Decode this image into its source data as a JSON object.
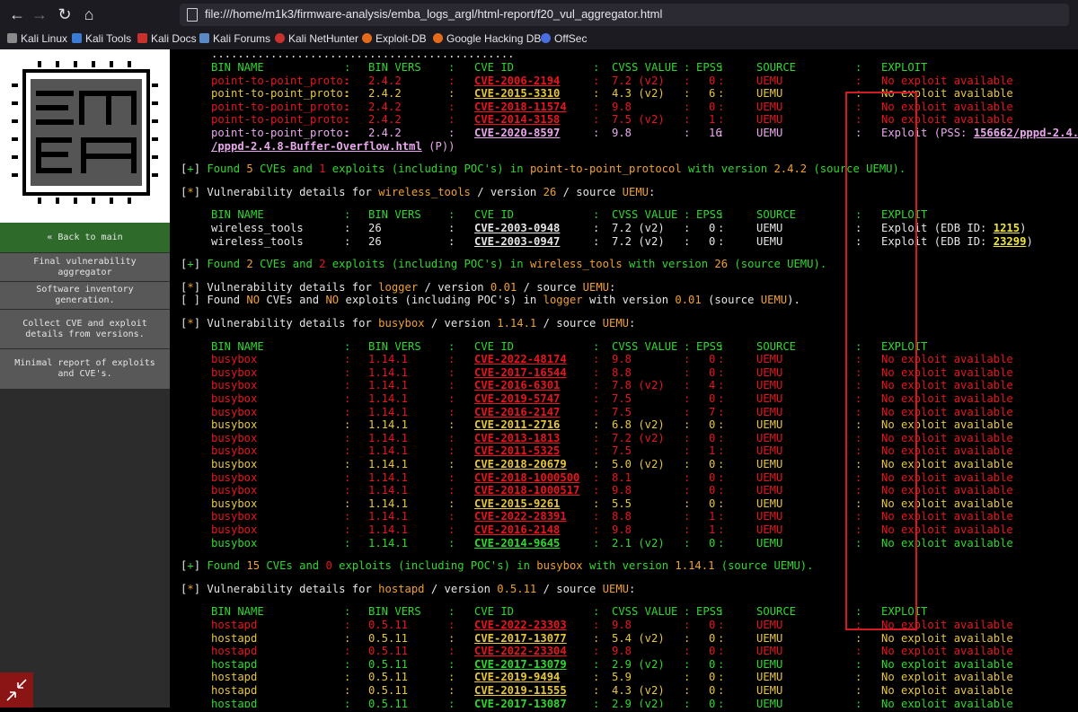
{
  "browser": {
    "url": "file:///home/m1k3/firmware-analysis/emba_logs_argl/html-report/f20_vul_aggregator.html",
    "bookmarks": [
      "Kali Linux",
      "Kali Tools",
      "Kali Docs",
      "Kali Forums",
      "Kali NetHunter",
      "Exploit-DB",
      "Google Hacking DB",
      "OffSec"
    ]
  },
  "sidebar": {
    "back_label": "« Back to main",
    "items": [
      "Final vulnerability aggregator",
      "Software inventory generation.",
      "Collect CVE and exploit details from versions.",
      "Minimal report of exploits and CVE's."
    ]
  },
  "headers": {
    "bin_name": "BIN NAME",
    "bin_vers": "BIN VERS",
    "cve_id": "CVE ID",
    "cvss_value": "CVSS VALUE",
    "epss": "EPSS",
    "source": "SOURCE",
    "exploit": "EXPLOIT"
  },
  "sections": [
    {
      "rows": [
        {
          "bin": "point-to-point_proto:",
          "vers": "2.4.2",
          "cve": "CVE-2006-2194",
          "cvss": "7.2 (v2)",
          "epss": "0",
          "src": "UEMU",
          "exploit": "No exploit available",
          "color": "r"
        },
        {
          "bin": "point-to-point_proto:",
          "vers": "2.4.2",
          "cve": "CVE-2015-3310",
          "cvss": "4.3 (v2)",
          "epss": "6",
          "src": "UEMU",
          "exploit": "No exploit available",
          "color": "y"
        },
        {
          "bin": "point-to-point_proto:",
          "vers": "2.4.2",
          "cve": "CVE-2018-11574",
          "cvss": "9.8",
          "epss": "0",
          "src": "UEMU",
          "exploit": "No exploit available",
          "color": "r"
        },
        {
          "bin": "point-to-point_proto:",
          "vers": "2.4.2",
          "cve": "CVE-2014-3158",
          "cvss": "7.5 (v2)",
          "epss": "1",
          "src": "UEMU",
          "exploit": "No exploit available",
          "color": "r"
        },
        {
          "bin": "point-to-point_proto:",
          "vers": "2.4.2",
          "cve": "CVE-2020-8597",
          "cvss": "9.8",
          "epss": "16",
          "src": "UEMU",
          "exploit": "Exploit (PSS: ",
          "exploit_link": "156662/pppd-2.4.",
          "color": "m"
        }
      ],
      "wrap": "/pppd-2.4.8-Buffer-Overflow.html",
      "wrap_suffix": " (P))",
      "summary": {
        "pre": "Found ",
        "cves": "5",
        "mid1": " CVEs and ",
        "exploits": "1",
        "mid2": " exploits (including POC's) in ",
        "name": "point-to-point_protocol",
        "mid3": " with version ",
        "version": "2.4.2",
        "post": " (source UEMU)."
      }
    },
    {
      "header": {
        "pre": "Vulnerability details for ",
        "name": "wireless_tools",
        "mid": " / version ",
        "version": "26",
        "post": " / source ",
        "src": "UEMU",
        ":": ":"
      },
      "rows": [
        {
          "bin": "wireless_tools",
          "vers": "26",
          "cve": "CVE-2003-0948",
          "cvss": "7.2 (v2)",
          "epss": "0",
          "src": "UEMU",
          "exploit": "Exploit (EDB ID: ",
          "exploit_link": "1215",
          "exploit_post": ")",
          "color": "w"
        },
        {
          "bin": "wireless_tools",
          "vers": "26",
          "cve": "CVE-2003-0947",
          "cvss": "7.2 (v2)",
          "epss": "0",
          "src": "UEMU",
          "exploit": "Exploit (EDB ID: ",
          "exploit_link": "23299",
          "exploit_post": ")",
          "color": "w"
        }
      ],
      "summary": {
        "pre": "Found ",
        "cves": "2",
        "mid1": " CVEs and ",
        "exploits": "2",
        "mid2": " exploits (including POC's) in ",
        "name": "wireless_tools",
        "mid3": " with version ",
        "version": "26",
        "post": " (source UEMU)."
      }
    },
    {
      "header": {
        "pre": "Vulnerability details for ",
        "name": "logger",
        "mid": " / version ",
        "version": "0.01",
        "post": " / source ",
        "src": "UEMU"
      },
      "none": {
        "pre": "Found ",
        "no1": "NO",
        "mid1": " CVEs and ",
        "no2": "NO",
        "mid2": " exploits (including POC's) in ",
        "name": "logger",
        "mid3": " with version ",
        "version": "0.01",
        "post": " (source ",
        "src": "UEMU",
        "end": ")."
      }
    },
    {
      "header": {
        "pre": "Vulnerability details for ",
        "name": "busybox",
        "mid": " / version ",
        "version": "1.14.1",
        "post": " / source ",
        "src": "UEMU"
      },
      "rows": [
        {
          "bin": "busybox",
          "vers": "1.14.1",
          "cve": "CVE-2022-48174",
          "cvss": "9.8",
          "epss": "0",
          "src": "UEMU",
          "exploit": "No exploit available",
          "color": "r"
        },
        {
          "bin": "busybox",
          "vers": "1.14.1",
          "cve": "CVE-2017-16544",
          "cvss": "8.8",
          "epss": "0",
          "src": "UEMU",
          "exploit": "No exploit available",
          "color": "r"
        },
        {
          "bin": "busybox",
          "vers": "1.14.1",
          "cve": "CVE-2016-6301",
          "cvss": "7.8 (v2)",
          "epss": "4",
          "src": "UEMU",
          "exploit": "No exploit available",
          "color": "r"
        },
        {
          "bin": "busybox",
          "vers": "1.14.1",
          "cve": "CVE-2019-5747",
          "cvss": "7.5",
          "epss": "0",
          "src": "UEMU",
          "exploit": "No exploit available",
          "color": "r"
        },
        {
          "bin": "busybox",
          "vers": "1.14.1",
          "cve": "CVE-2016-2147",
          "cvss": "7.5",
          "epss": "7",
          "src": "UEMU",
          "exploit": "No exploit available",
          "color": "r"
        },
        {
          "bin": "busybox",
          "vers": "1.14.1",
          "cve": "CVE-2011-2716",
          "cvss": "6.8 (v2)",
          "epss": "0",
          "src": "UEMU",
          "exploit": "No exploit available",
          "color": "y"
        },
        {
          "bin": "busybox",
          "vers": "1.14.1",
          "cve": "CVE-2013-1813",
          "cvss": "7.2 (v2)",
          "epss": "0",
          "src": "UEMU",
          "exploit": "No exploit available",
          "color": "r"
        },
        {
          "bin": "busybox",
          "vers": "1.14.1",
          "cve": "CVE-2011-5325",
          "cvss": "7.5",
          "epss": "1",
          "src": "UEMU",
          "exploit": "No exploit available",
          "color": "r"
        },
        {
          "bin": "busybox",
          "vers": "1.14.1",
          "cve": "CVE-2018-20679",
          "cvss": "5.0 (v2)",
          "epss": "0",
          "src": "UEMU",
          "exploit": "No exploit available",
          "color": "y"
        },
        {
          "bin": "busybox",
          "vers": "1.14.1",
          "cve": "CVE-2018-1000500",
          "cvss": "8.1",
          "epss": "0",
          "src": "UEMU",
          "exploit": "No exploit available",
          "color": "r"
        },
        {
          "bin": "busybox",
          "vers": "1.14.1",
          "cve": "CVE-2018-1000517",
          "cvss": "9.8",
          "epss": "0",
          "src": "UEMU",
          "exploit": "No exploit available",
          "color": "r"
        },
        {
          "bin": "busybox",
          "vers": "1.14.1",
          "cve": "CVE-2015-9261",
          "cvss": "5.5",
          "epss": "0",
          "src": "UEMU",
          "exploit": "No exploit available",
          "color": "y"
        },
        {
          "bin": "busybox",
          "vers": "1.14.1",
          "cve": "CVE-2022-28391",
          "cvss": "8.8",
          "epss": "1",
          "src": "UEMU",
          "exploit": "No exploit available",
          "color": "r"
        },
        {
          "bin": "busybox",
          "vers": "1.14.1",
          "cve": "CVE-2016-2148",
          "cvss": "9.8",
          "epss": "1",
          "src": "UEMU",
          "exploit": "No exploit available",
          "color": "r"
        },
        {
          "bin": "busybox",
          "vers": "1.14.1",
          "cve": "CVE-2014-9645",
          "cvss": "2.1 (v2)",
          "epss": "0",
          "src": "UEMU",
          "exploit": "No exploit available",
          "color": "g"
        }
      ],
      "summary": {
        "pre": "Found ",
        "cves": "15",
        "mid1": " CVEs and ",
        "exploits": "0",
        "mid2": " exploits (including POC's) in ",
        "name": "busybox",
        "mid3": " with version ",
        "version": "1.14.1",
        "post": " (source UEMU)."
      }
    },
    {
      "header": {
        "pre": "Vulnerability details for ",
        "name": "hostapd",
        "mid": " / version ",
        "version": "0.5.11",
        "post": " / source ",
        "src": "UEMU"
      },
      "rows": [
        {
          "bin": "hostapd",
          "vers": "0.5.11",
          "cve": "CVE-2022-23303",
          "cvss": "9.8",
          "epss": "0",
          "src": "UEMU",
          "exploit": "No exploit available",
          "color": "r"
        },
        {
          "bin": "hostapd",
          "vers": "0.5.11",
          "cve": "CVE-2017-13077",
          "cvss": "5.4 (v2)",
          "epss": "0",
          "src": "UEMU",
          "exploit": "No exploit available",
          "color": "y"
        },
        {
          "bin": "hostapd",
          "vers": "0.5.11",
          "cve": "CVE-2022-23304",
          "cvss": "9.8",
          "epss": "0",
          "src": "UEMU",
          "exploit": "No exploit available",
          "color": "r"
        },
        {
          "bin": "hostapd",
          "vers": "0.5.11",
          "cve": "CVE-2017-13079",
          "cvss": "2.9 (v2)",
          "epss": "0",
          "src": "UEMU",
          "exploit": "No exploit available",
          "color": "g"
        },
        {
          "bin": "hostapd",
          "vers": "0.5.11",
          "cve": "CVE-2019-9494",
          "cvss": "5.9",
          "epss": "0",
          "src": "UEMU",
          "exploit": "No exploit available",
          "color": "y"
        },
        {
          "bin": "hostapd",
          "vers": "0.5.11",
          "cve": "CVE-2019-11555",
          "cvss": "4.3 (v2)",
          "epss": "0",
          "src": "UEMU",
          "exploit": "No exploit available",
          "color": "y"
        },
        {
          "bin": "hostapd",
          "vers": "0.5.11",
          "cve": "CVE-2017-13087",
          "cvss": "2.9 (v2)",
          "epss": "0",
          "src": "UEMU",
          "exploit": "No exploit available",
          "color": "g"
        }
      ]
    }
  ],
  "colors": {
    "accent_green": "#2fd82f",
    "warning_yellow": "#e8c63c",
    "critical_red": "#e8141e",
    "highlight_box": "#d31a22",
    "back_button": "#2e6a2a"
  }
}
